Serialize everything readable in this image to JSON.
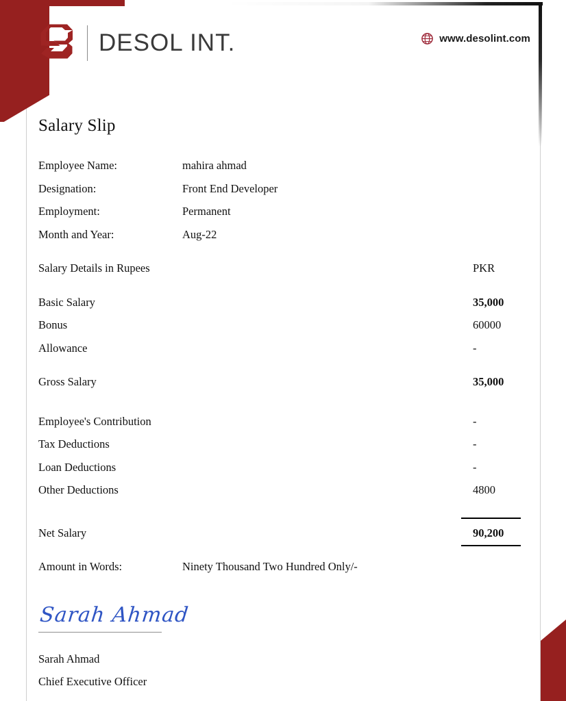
{
  "document": {
    "title": "Salary Slip"
  },
  "header": {
    "brand_name": "DESOL INT.",
    "logo_icon": "desol-hexagon-s-logo",
    "website_icon": "globe-icon",
    "website": "www.desolint.com"
  },
  "employee": {
    "rows": [
      {
        "label": "Employee Name:",
        "value": "mahira ahmad"
      },
      {
        "label": "Designation:",
        "value": "Front End Developer"
      },
      {
        "label": "Employment:",
        "value": "Permanent"
      },
      {
        "label": "Month and Year:",
        "value": "Aug-22"
      }
    ]
  },
  "salary": {
    "section_label": "Salary Details in Rupees",
    "currency": "PKR",
    "earnings": [
      {
        "label": "Basic Salary",
        "value": "35,000",
        "bold": true
      },
      {
        "label": "Bonus",
        "value": "60000",
        "bold": false
      },
      {
        "label": "Allowance",
        "value": "-",
        "bold": false
      }
    ],
    "gross": {
      "label": "Gross Salary",
      "value": "35,000"
    },
    "deductions": [
      {
        "label": "Employee's Contribution",
        "value": "-"
      },
      {
        "label": "Tax Deductions",
        "value": "-"
      },
      {
        "label": "Loan Deductions",
        "value": "-"
      },
      {
        "label": "Other Deductions",
        "value": "4800"
      }
    ],
    "net": {
      "label": "Net Salary",
      "value": "90,200"
    },
    "amount_in_words": {
      "label": "Amount in Words:",
      "value": "Ninety Thousand Two Hundred Only/-"
    }
  },
  "signature": {
    "signature_text": "Sarah Ahmad",
    "name": "Sarah Ahmad",
    "title": "Chief Executive Officer"
  },
  "colors": {
    "brand_red": "#96201f",
    "logo_red": "#9e2423",
    "signature_blue": "#2f55c4",
    "text": "#111111"
  }
}
